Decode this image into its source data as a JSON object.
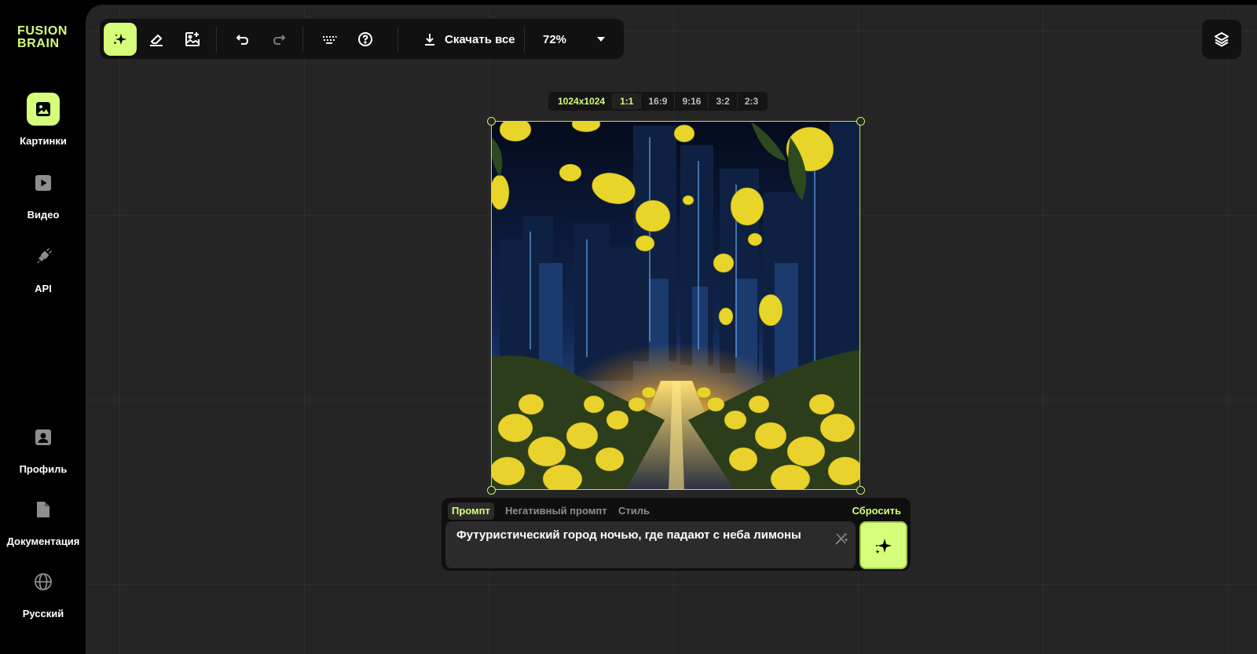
{
  "brand": {
    "line1": "FUSION",
    "line2": "BRAIN",
    "accent": "#d5ff7a"
  },
  "sidebar": {
    "items": [
      {
        "label": "Картинки",
        "icon": "image-icon",
        "active": true
      },
      {
        "label": "Видео",
        "icon": "video-play-icon",
        "active": false
      },
      {
        "label": "API",
        "icon": "plug-icon",
        "active": false
      },
      {
        "label": "Профиль",
        "icon": "profile-icon",
        "active": false
      },
      {
        "label": "Документация",
        "icon": "document-icon",
        "active": false
      },
      {
        "label": "Русский",
        "icon": "globe-icon",
        "active": false
      }
    ]
  },
  "toolbar": {
    "tools": [
      {
        "icon": "sparkle-generate-icon",
        "active": true
      },
      {
        "icon": "eraser-icon",
        "active": false
      },
      {
        "icon": "image-edit-icon",
        "active": false
      },
      {
        "icon": "undo-icon",
        "active": false
      },
      {
        "icon": "redo-icon",
        "active": false
      },
      {
        "icon": "keyboard-icon",
        "active": false
      },
      {
        "icon": "help-icon",
        "active": false
      }
    ],
    "download_label": "Скачать все",
    "zoom": "72%"
  },
  "canvas": {
    "resolution": "1024x1024",
    "ratios": [
      "1:1",
      "16:9",
      "9:16",
      "3:2",
      "2:3"
    ],
    "active_ratio": "1:1"
  },
  "prompt": {
    "tabs": [
      "Промпт",
      "Негативный промпт",
      "Стиль"
    ],
    "active_tab": "Промпт",
    "reset_label": "Сбросить",
    "value": "Футуристический город ночью, где падают с неба лимоны"
  }
}
